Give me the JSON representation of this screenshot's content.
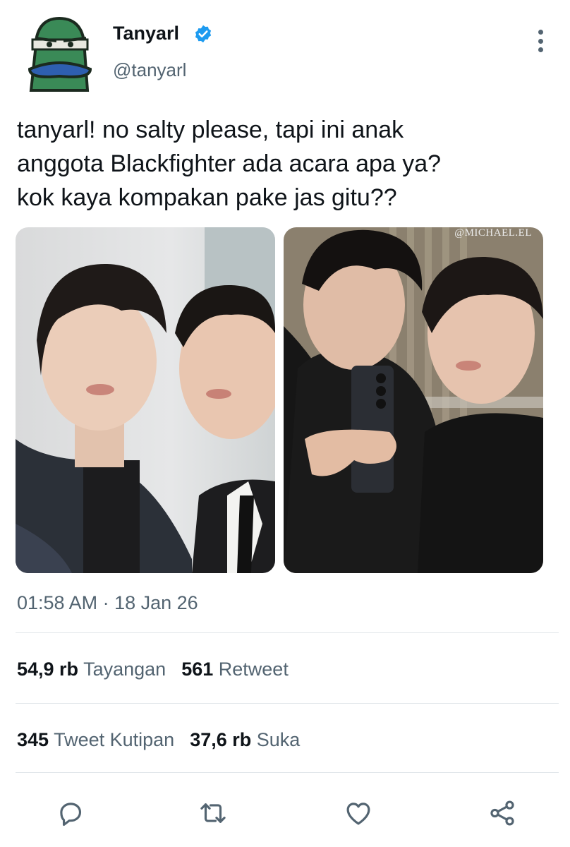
{
  "author": {
    "display_name": "Tanyarl",
    "handle": "@tanyarl",
    "verified_icon": "verified-badge-icon",
    "avatar": "green-character-avatar"
  },
  "tweet": {
    "text": "tanyarl! no salty please, tapi ini anak\nanggota Blackfighter ada acara apa ya?\nkok kaya kompakan pake jas gitu??"
  },
  "media": {
    "count": 2,
    "right_watermark": "@MICHAEL.EL"
  },
  "meta": {
    "timestamp": "01:58 AM · 18 Jan 26"
  },
  "stats": {
    "views_count": "54,9 rb",
    "views_label": "Tayangan",
    "retweets_count": "561",
    "retweets_label": "Retweet",
    "quotes_count": "345",
    "quotes_label": "Tweet Kutipan",
    "likes_count": "37,6 rb",
    "likes_label": "Suka"
  },
  "actions": [
    {
      "icon": "reply-icon"
    },
    {
      "icon": "retweet-icon"
    },
    {
      "icon": "like-icon"
    },
    {
      "icon": "share-icon"
    }
  ],
  "colors": {
    "text_primary": "#0f1419",
    "text_secondary": "#536471",
    "verified_blue": "#1d9bf0",
    "divider": "#e1e6ea"
  }
}
